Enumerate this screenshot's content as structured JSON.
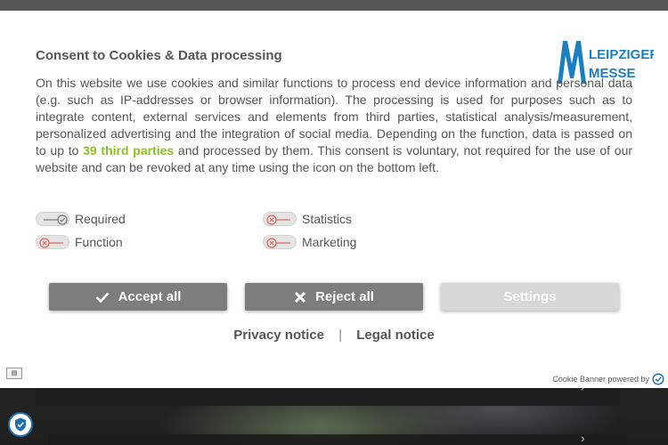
{
  "dialog": {
    "title": "Consent to Cookies & Data processing",
    "text_before_link": "On this website we use cookies and similar functions to process end device information and personal data (e.g. such as IP-addresses or browser information). The processing is used for purposes such as to integrate content, external services and elements from third parties, statistical analysis/measurement, personalized advertising and the integration of social media. Depending on the function, data is passed on to up to ",
    "third_parties_link": "39 third parties",
    "text_after_link": " and processed by them. This consent is voluntary, not required for the use of our website and can be revoked at any time using the icon on the bottom left.",
    "logo": {
      "line1": "LEIPZIGER",
      "line2": "MESSE",
      "color": "#1a7fc1"
    }
  },
  "toggles": [
    {
      "label": "Required",
      "state": "on-locked"
    },
    {
      "label": "Statistics",
      "state": "off"
    },
    {
      "label": "Function",
      "state": "off"
    },
    {
      "label": "Marketing",
      "state": "off"
    }
  ],
  "buttons": {
    "accept_all": "Accept all",
    "reject_all": "Reject all",
    "settings": "Settings"
  },
  "links": {
    "privacy": "Privacy notice",
    "separator": "|",
    "legal": "Legal notice"
  },
  "footer": {
    "powered_by": "Cookie Banner powered by",
    "language_icon": "flag-icon"
  },
  "colors": {
    "link_green": "#8fbf1d",
    "off_red": "#e0645a",
    "button_dark": "#7d7d7d",
    "button_light": "#d7d7d7"
  }
}
